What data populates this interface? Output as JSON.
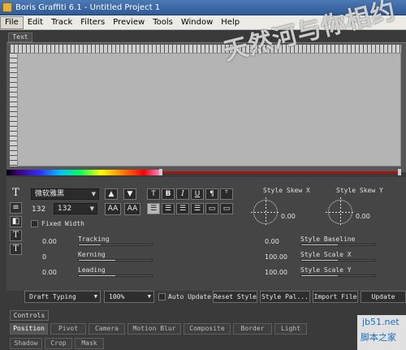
{
  "window": {
    "title": "Boris Graffiti 6.1 - Untitled Project 1"
  },
  "menu": [
    "File",
    "Edit",
    "Track",
    "Filters",
    "Preview",
    "Tools",
    "Window",
    "Help"
  ],
  "text_panel": {
    "tab_label": "Text",
    "watermark": "天然河与你相约"
  },
  "style": {
    "font_name": "微软雅黑",
    "font_size": "132",
    "font_size_select": "132",
    "size_buttons": [
      "AA",
      "AA"
    ],
    "format_buttons": [
      "T",
      "B",
      "I",
      "U",
      "¶",
      "ᵀ"
    ],
    "fixed_width_label": "Fixed Width",
    "skew_x_label": "Style Skew X",
    "skew_y_label": "Style Skew Y",
    "skew_x_value": "0.00",
    "skew_y_value": "0.00",
    "rows": [
      {
        "left_value": "0.00",
        "left_label": "Tracking",
        "left_fill": 0.3,
        "right_value": "0.00",
        "right_label": "Style Baseline",
        "right_fill": 0.5
      },
      {
        "left_value": "0",
        "left_label": "Kerning",
        "left_fill": 0.5,
        "right_value": "100.00",
        "right_label": "Style Scale X",
        "right_fill": 0.5
      },
      {
        "left_value": "0.00",
        "left_label": "Leading",
        "left_fill": 0.5,
        "right_value": "100.00",
        "right_label": "Style Scale Y",
        "right_fill": 0.5
      }
    ]
  },
  "toolbar": {
    "draft_typing": "Draft Typing",
    "zoom": "100%",
    "auto_update": "Auto Update",
    "reset_style": "Reset Style",
    "style_palette": "Style Pal...",
    "import_file": "Import File",
    "update": "Update"
  },
  "controls": {
    "title": "Controls",
    "tabs_row1": [
      "Position",
      "Pivot",
      "Camera",
      "Motion Blur",
      "Composite",
      "Border",
      "Light"
    ],
    "tabs_row2": [
      "Shadow",
      "Crop",
      "Mask"
    ]
  },
  "site_watermark": {
    "line1": "jb51.net",
    "line2": "脚本之家"
  },
  "colors": {
    "title_bar": "#3a68a8",
    "menu_bar": "#ecebe6",
    "panel_bg": "#454545",
    "canvas": "#b4b4b4",
    "track_red": "#a01414"
  }
}
